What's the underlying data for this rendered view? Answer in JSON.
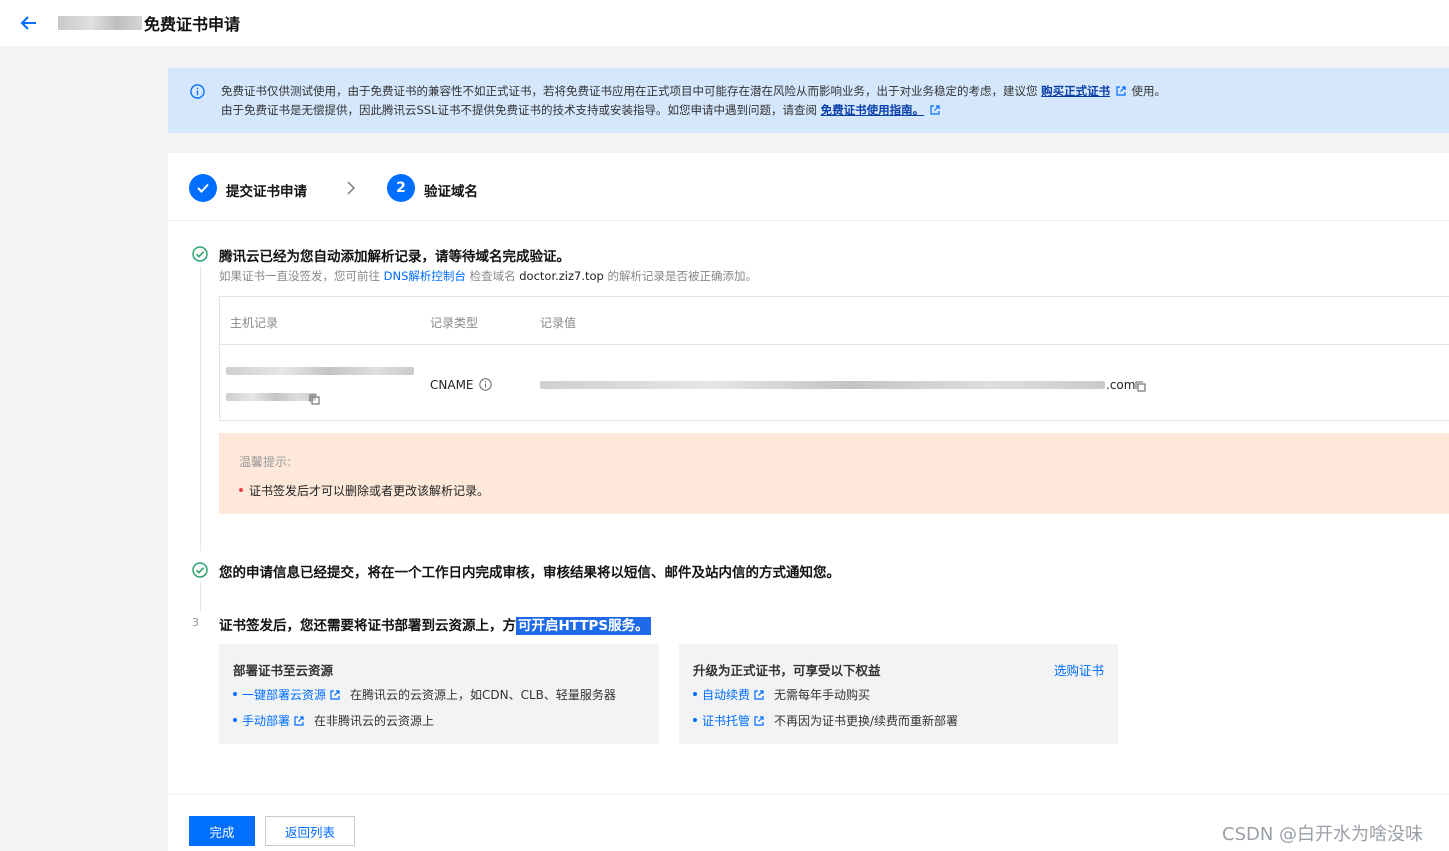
{
  "header": {
    "title": "免费证书申请"
  },
  "notice": {
    "line1_text": "免费证书仅供测试使用，由于免费证书的兼容性不如正式证书，若将免费证书应用在正式项目中可能存在潜在风险从而影响业务，出于对业务稳定的考虑，建议您",
    "line1_link": "购买正式证书",
    "line1_suffix": "使用。",
    "line2_text": "由于免费证书是无偿提供，因此腾讯云SSL证书不提供免费证书的技术支持或安装指导。如您申请中遇到问题，请查阅",
    "line2_link": "免费证书使用指南。"
  },
  "steps": [
    {
      "label": "提交证书申请",
      "status": "done"
    },
    {
      "number": "2",
      "label": "验证域名",
      "status": "current"
    }
  ],
  "section1": {
    "title": "腾讯云已经为您自动添加解析记录，请等待域名完成验证。",
    "sub_prefix": "如果证书一直没签发，您可前往",
    "sub_link": "DNS解析控制台",
    "sub_mid": "检查域名",
    "sub_domain": "doctor.ziz7.top",
    "sub_suffix": "的解析记录是否被正确添加。"
  },
  "record_table": {
    "headers": [
      "主机记录",
      "记录类型",
      "记录值"
    ],
    "row": {
      "type": "CNAME",
      "value_suffix": ".com"
    }
  },
  "warning": {
    "title": "温馨提示:",
    "item": "证书签发后才可以删除或者更改该解析记录。"
  },
  "section2": {
    "title": "您的申请信息已经提交，将在一个工作日内完成审核，审核结果将以短信、邮件及站内信的方式通知您。"
  },
  "section3": {
    "number": "3",
    "title_plain": "证书签发后，您还需要将证书部署到云资源上，方",
    "title_highlight": "可开启HTTPS服务。"
  },
  "deploy_box": {
    "title": "部署证书至云资源",
    "items": [
      {
        "link": "一键部署云资源",
        "desc": "在腾讯云的云资源上，如CDN、CLB、轻量服务器"
      },
      {
        "link": "手动部署",
        "desc": "在非腾讯云的云资源上"
      }
    ]
  },
  "upgrade_box": {
    "title": "升级为正式证书，可享受以下权益",
    "action": "选购证书",
    "items": [
      {
        "link": "自动续费",
        "desc": "无需每年手动购买"
      },
      {
        "link": "证书托管",
        "desc": "不再因为证书更换/续费而重新部署"
      }
    ]
  },
  "buttons": {
    "done": "完成",
    "back": "返回列表"
  },
  "watermark": "CSDN @白开水为啥没味",
  "colors": {
    "primary": "#006eff",
    "notice_bg": "#d5e7fd",
    "warning_bg": "#fde8da",
    "success": "#2ba471"
  }
}
